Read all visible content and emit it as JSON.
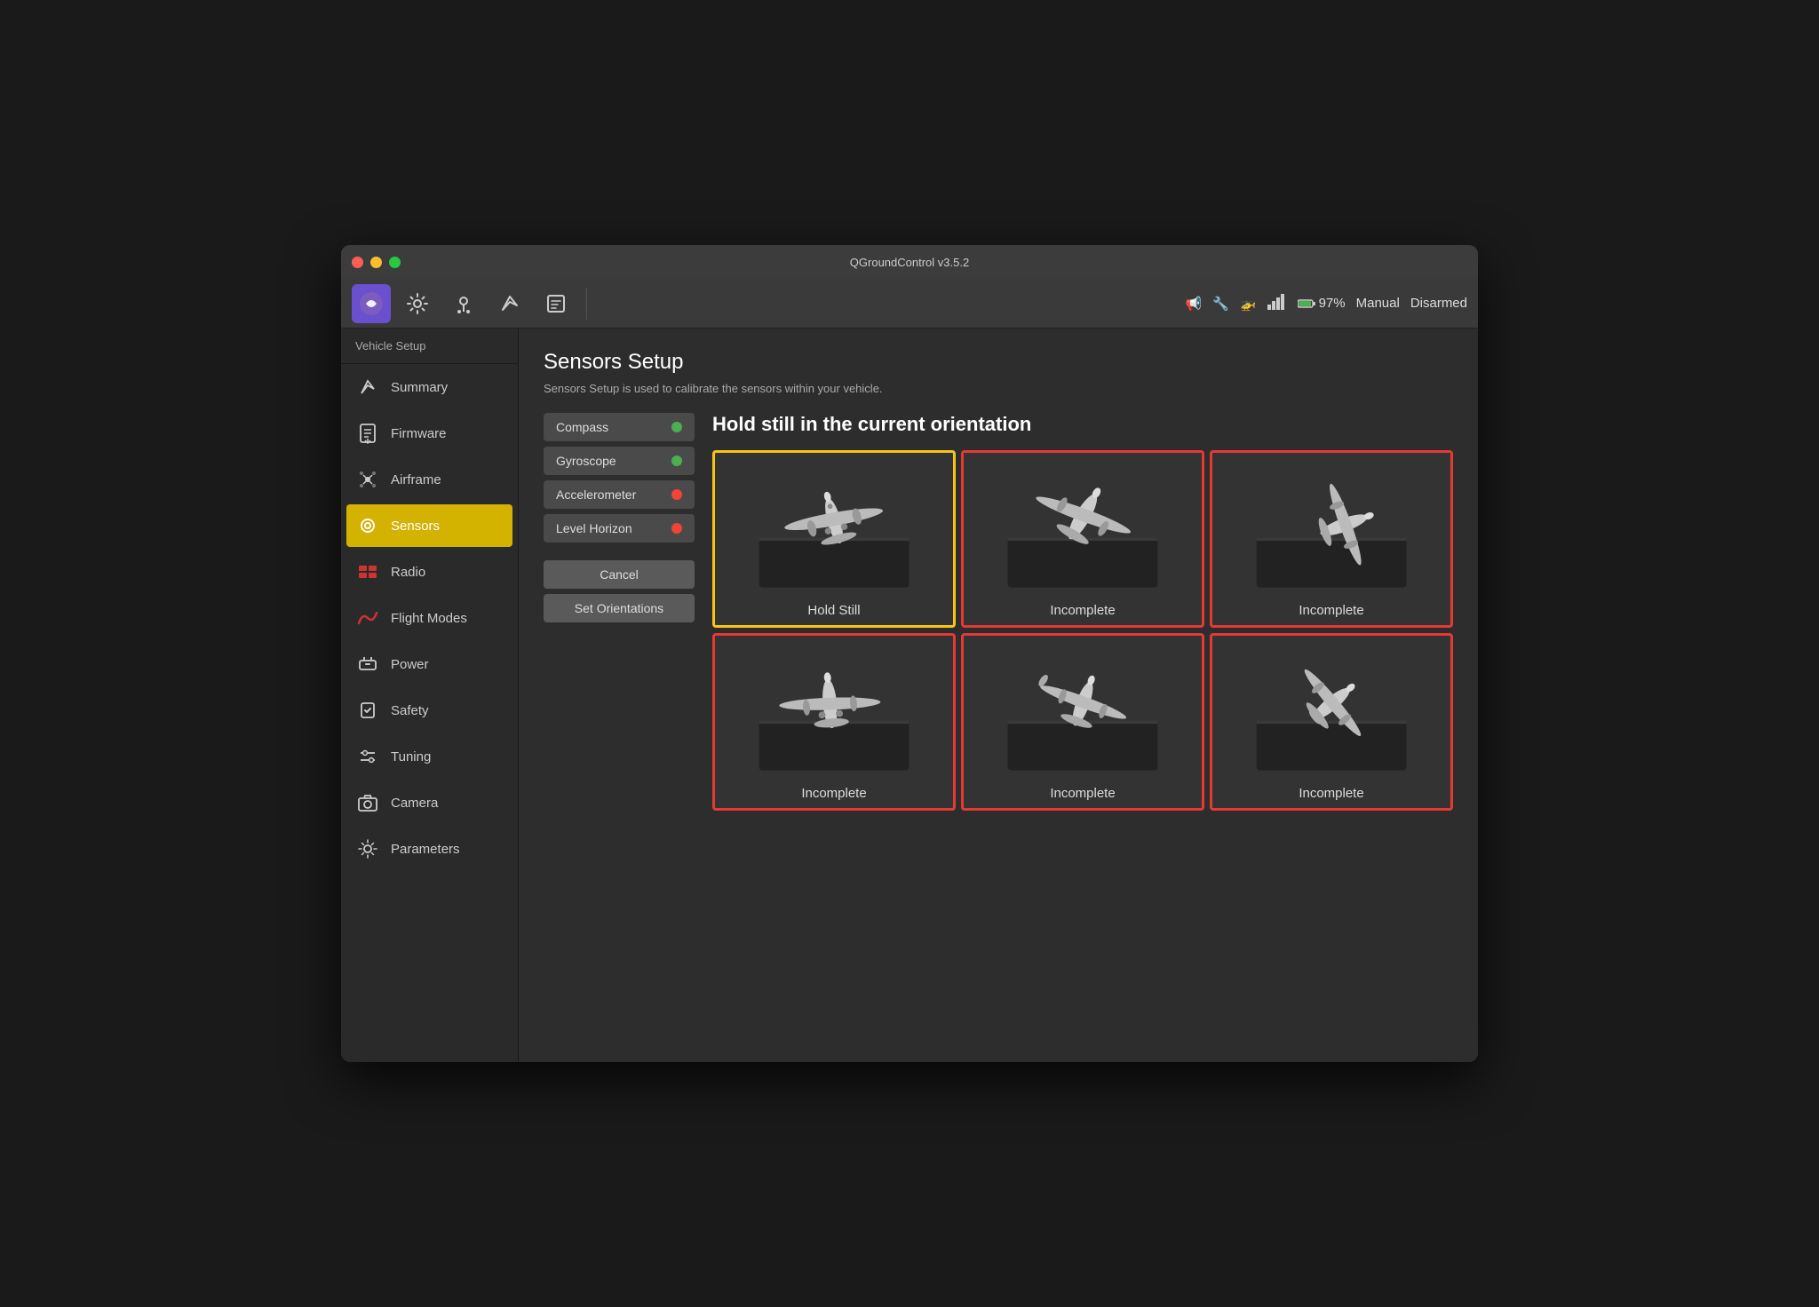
{
  "window": {
    "title": "QGroundControl v3.5.2"
  },
  "toolbar": {
    "icons": [
      "qgc",
      "gear",
      "waypoint",
      "send",
      "document"
    ],
    "right": {
      "megaphone": "📢",
      "wrench": "🔧",
      "vehicle": "🚁",
      "signal": "📶",
      "battery": "97%",
      "mode": "Manual",
      "arm": "Disarmed"
    }
  },
  "sidebar": {
    "header": "Vehicle Setup",
    "items": [
      {
        "id": "summary",
        "label": "Summary",
        "icon": "send"
      },
      {
        "id": "firmware",
        "label": "Firmware",
        "icon": "download"
      },
      {
        "id": "airframe",
        "label": "Airframe",
        "icon": "airframe"
      },
      {
        "id": "sensors",
        "label": "Sensors",
        "icon": "sensors",
        "active": true
      },
      {
        "id": "radio",
        "label": "Radio",
        "icon": "radio"
      },
      {
        "id": "flightmodes",
        "label": "Flight Modes",
        "icon": "flightmodes"
      },
      {
        "id": "power",
        "label": "Power",
        "icon": "power"
      },
      {
        "id": "safety",
        "label": "Safety",
        "icon": "safety"
      },
      {
        "id": "tuning",
        "label": "Tuning",
        "icon": "tuning"
      },
      {
        "id": "camera",
        "label": "Camera",
        "icon": "camera"
      },
      {
        "id": "parameters",
        "label": "Parameters",
        "icon": "parameters"
      }
    ]
  },
  "content": {
    "title": "Sensors Setup",
    "description": "Sensors Setup is used to calibrate the sensors within your vehicle.",
    "sensor_buttons": [
      {
        "label": "Compass",
        "status": "green"
      },
      {
        "label": "Gyroscope",
        "status": "green"
      },
      {
        "label": "Accelerometer",
        "status": "red"
      },
      {
        "label": "Level Horizon",
        "status": "red"
      }
    ],
    "cancel_label": "Cancel",
    "set_orientations_label": "Set Orientations",
    "calibration_header": "Hold still in the current orientation",
    "orientation_cells": [
      {
        "label": "Hold Still",
        "state": "active"
      },
      {
        "label": "Incomplete",
        "state": "incomplete"
      },
      {
        "label": "Incomplete",
        "state": "incomplete"
      },
      {
        "label": "Incomplete",
        "state": "incomplete"
      },
      {
        "label": "Incomplete",
        "state": "incomplete"
      },
      {
        "label": "Incomplete",
        "state": "incomplete"
      }
    ]
  }
}
